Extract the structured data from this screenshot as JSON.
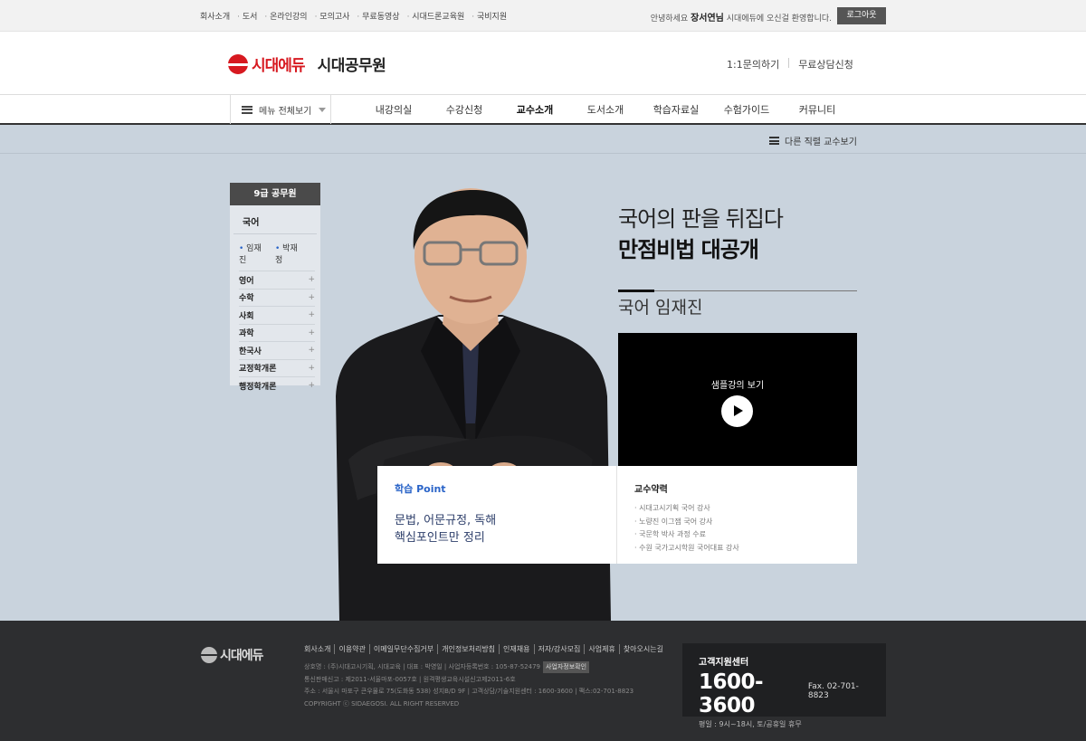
{
  "topbar": {
    "links": [
      "회사소개",
      "도서",
      "온라인강의",
      "모의고사",
      "무료동영상",
      "시대드론교육원",
      "국비지원"
    ],
    "greeting_prefix": "안녕하세요",
    "user_name": "장서연님",
    "greeting_suffix": "시대에듀에 오신걸 환영합니다.",
    "logout_label": "로그아웃"
  },
  "header": {
    "logo_name": "시대에듀",
    "logo_sub": "시대공무원",
    "links": [
      "1:1문의하기",
      "무료상담신청"
    ]
  },
  "nav": {
    "menu_all_label": "메뉴 전체보기",
    "items": [
      "내강의실",
      "수강신청",
      "교수소개",
      "도서소개",
      "학습자료실",
      "수험가이드",
      "커뮤니티"
    ],
    "active_index": 2
  },
  "subbar": {
    "other_label": "다른 직렬 교수보기"
  },
  "sidebar": {
    "title": "9급 공무원",
    "current_category": "국어",
    "professors": [
      "임재진",
      "박재정"
    ],
    "categories": [
      "영어",
      "수학",
      "사회",
      "과학",
      "한국사",
      "교정학개론",
      "행정학개론"
    ],
    "expand_symbol": "+"
  },
  "hero": {
    "headline1": "국어의 판을 뒤집다",
    "headline2": "만점비법 대공개",
    "professor_title": "국어 임재진"
  },
  "video": {
    "label": "샘플강의 보기",
    "play_icon": "play-icon"
  },
  "info": {
    "point_title": "학습 Point",
    "point_text_line1": "문법, 어문규정, 독해",
    "point_text_line2": "핵심포인트만 정리",
    "career_title": "교수약력",
    "career_items": [
      "시대고시기획 국어 강사",
      "노량진 이그잼 국어 강사",
      "국문학 박사 과정 수료",
      "수원 국가고시학원 국어대표 강사"
    ]
  },
  "footer": {
    "logo_name": "시대에듀",
    "links": [
      "회사소개",
      "이용약관",
      "이메일무단수집거부",
      "개인정보처리방침",
      "인재채용",
      "저자/강사모집",
      "사업제휴",
      "찾아오시는길"
    ],
    "info_line1": "상호명 : (주)시대고시기획, 시대교육 | 대표 : 박영일 | 사업자등록번호 : 105-87-52479",
    "biz_button": "사업자정보확인",
    "info_line2": "통신판매신고 : 제2011-서울마포-0057호 | 원격평생교육시설신고제2011-6호",
    "info_line3": "주소 : 서울시 마포구 큰우물로 75(도화동 538) 성지B/D 9F | 고객상담/기술지원센터 : 1600-3600 | 팩스:02-701-8823",
    "copyright": "COPYRIGHT ⓒ SIDAEGOSI. ALL RIGHT RESERVED",
    "cs_title": "고객지원센터",
    "cs_phone": "1600-3600",
    "cs_fax": "Fax. 02-701-8823",
    "cs_hours": "평일 : 9시~18시, 토/공휴일 휴무"
  },
  "colors": {
    "brand_red": "#d71920",
    "main_bg": "#c9d3dd",
    "footer_bg": "#2d2e30",
    "accent_blue": "#2a64c8"
  }
}
